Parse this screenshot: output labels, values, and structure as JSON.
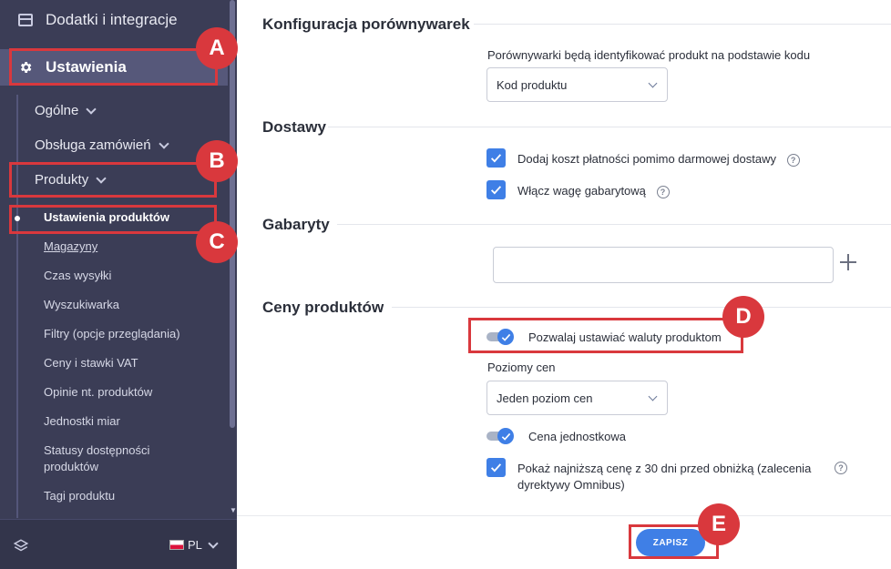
{
  "sidebar": {
    "top_item": "Dodatki i integracje",
    "active_section": "Ustawienia",
    "level2": [
      {
        "label": "Ogólne"
      },
      {
        "label": "Obsługa zamówień"
      },
      {
        "label": "Produkty"
      }
    ],
    "level3": [
      {
        "label": "Ustawienia produktów"
      },
      {
        "label": "Magazyny"
      },
      {
        "label": "Czas wysyłki"
      },
      {
        "label": "Wyszukiwarka"
      },
      {
        "label": "Filtry (opcje przeglądania)"
      },
      {
        "label": "Ceny i stawki VAT"
      },
      {
        "label": "Opinie nt. produktów"
      },
      {
        "label": "Jednostki miar"
      },
      {
        "label": "Statusy dostępności produktów"
      },
      {
        "label": "Tagi produktu"
      }
    ],
    "language": "PL"
  },
  "main": {
    "comparators": {
      "title": "Konfiguracja porównywarek",
      "field_label": "Porównywarki będą identyfikować produkt na podstawie kodu",
      "select_value": "Kod produktu"
    },
    "shipping": {
      "title": "Dostawy",
      "checkbox1": "Dodaj koszt płatności pomimo darmowej dostawy",
      "checkbox2": "Włącz wagę gabarytową"
    },
    "dimensions": {
      "title": "Gabaryty"
    },
    "prices": {
      "title": "Ceny produktów",
      "toggle1": "Pozwalaj ustawiać waluty produktom",
      "levels_label": "Poziomy cen",
      "levels_value": "Jeden poziom cen",
      "toggle2": "Cena jednostkowa",
      "checkbox_omnibus": "Pokaż najniższą cenę z 30 dni przed obniżką (zalecenia dyrektywy Omnibus)"
    },
    "save_label": "ZAPISZ",
    "help_glyph": "?"
  },
  "annotations": {
    "a": "A",
    "b": "B",
    "c": "C",
    "d": "D",
    "e": "E",
    "color": "#d9383d"
  },
  "colors": {
    "sidebar_bg": "#3b3d56",
    "accent": "#3f7fe6"
  }
}
